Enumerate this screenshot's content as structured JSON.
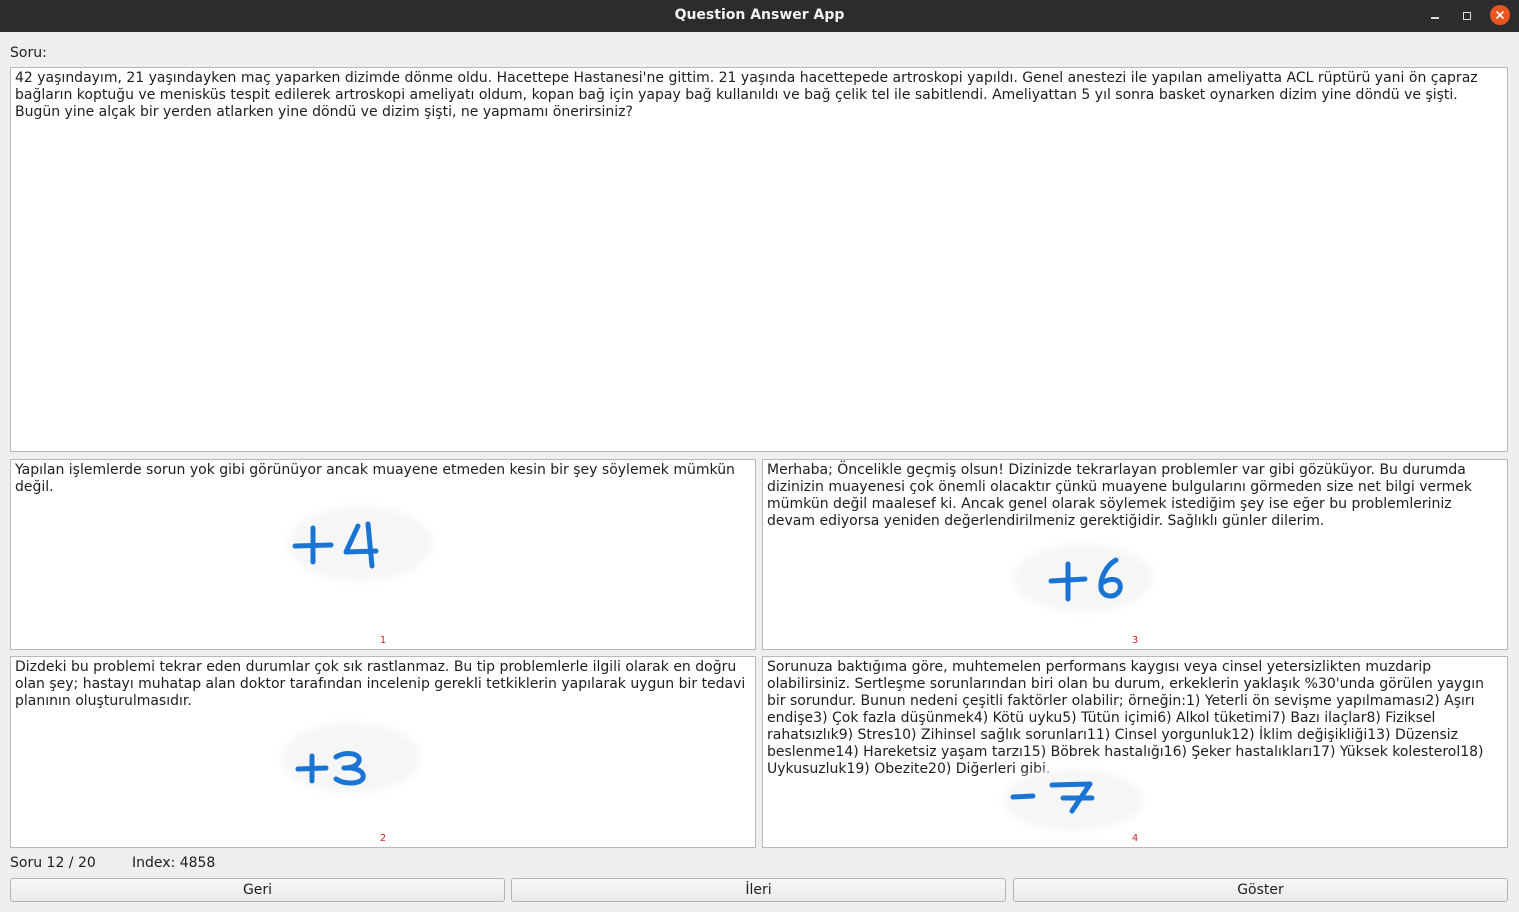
{
  "window": {
    "title": "Question Answer App"
  },
  "question_label": "Soru:",
  "question_text": "42 yaşındayım, 21 yaşındayken maç yaparken dizimde dönme oldu. Hacettepe Hastanesi'ne gittim. 21 yaşında hacettepede artroskopi yapıldı. Genel anestezi ile yapılan ameliyatta ACL rüptürü yani ön çapraz bağların koptuğu ve menisküs tespit edilerek artroskopi ameliyatı oldum, kopan bağ için yapay bağ kullanıldı ve bağ çelik tel ile sabitlendi. Ameliyattan 5 yıl sonra basket oynarken dizim yine döndü ve şişti. Bugün yine alçak bir yerden atlarken yine döndü ve dizim şişti, ne yapmamı önerirsiniz?",
  "answers": [
    {
      "text": "Yapılan işlemlerde sorun yok gibi görünüyor ancak muayene etmeden kesin bir şey söylemek mümkün değil.",
      "score": "+4",
      "number": "1"
    },
    {
      "text": "Merhaba; Öncelikle geçmiş olsun! Dizinizde tekrarlayan problemler var gibi gözüküyor. Bu durumda dizinizin muayenesi çok önemli olacaktır çünkü muayene bulgularını görmeden size net bilgi vermek mümkün değil maalesef ki. Ancak genel olarak söylemek istediğim şey ise eğer bu problemleriniz devam ediyorsa yeniden değerlendirilmeniz gerektiğidir. Sağlıklı günler dilerim.",
      "score": "+6",
      "number": "3"
    },
    {
      "text": "Dizdeki bu problemi tekrar eden durumlar çok sık rastlanmaz. Bu tip problemlerle ilgili olarak en doğru olan şey; hastayı muhatap alan doktor tarafından incelenip gerekli tetkiklerin yapılarak uygun bir tedavi planının oluşturulmasıdır.",
      "score": "+3",
      "number": "2"
    },
    {
      "text": "Sorunuza baktığıma göre, muhtemelen performans kaygısı veya cinsel yetersizlikten muzdarip olabilirsiniz. Sertleşme sorunlarından biri olan bu durum, erkeklerin yaklaşık %30'unda görülen yaygın bir sorundur. Bunun nedeni çeşitli faktörler olabilir; örneğin:1) Yeterli ön sevişme yapılmaması2) Aşırı endişe3) Çok fazla düşünmek4) Kötü uyku5) Tütün içimi6) Alkol tüketimi7) Bazı ilaçlar8) Fiziksel rahatsızlık9) Stres10) Zihinsel sağlık sorunları11) Cinsel yorgunluk12) İklim değişikliği13) Düzensiz beslenme14) Hareketsiz yaşam tarzı15) Böbrek hastalığı16) Şeker hastalıkları17) Yüksek kolesterol18) Uykusuzluk19) Obezite20) Diğerleri gibi.",
      "score": "-7",
      "number": "4"
    }
  ],
  "status": {
    "progress": "Soru 12 / 20",
    "index": "Index: 4858"
  },
  "buttons": {
    "back": "Geri",
    "next": "İleri",
    "show": "Göster"
  },
  "colors": {
    "ink": "#1a74d4",
    "number": "#c62828",
    "titlebar": "#2c2c2c",
    "close": "#e95420"
  }
}
